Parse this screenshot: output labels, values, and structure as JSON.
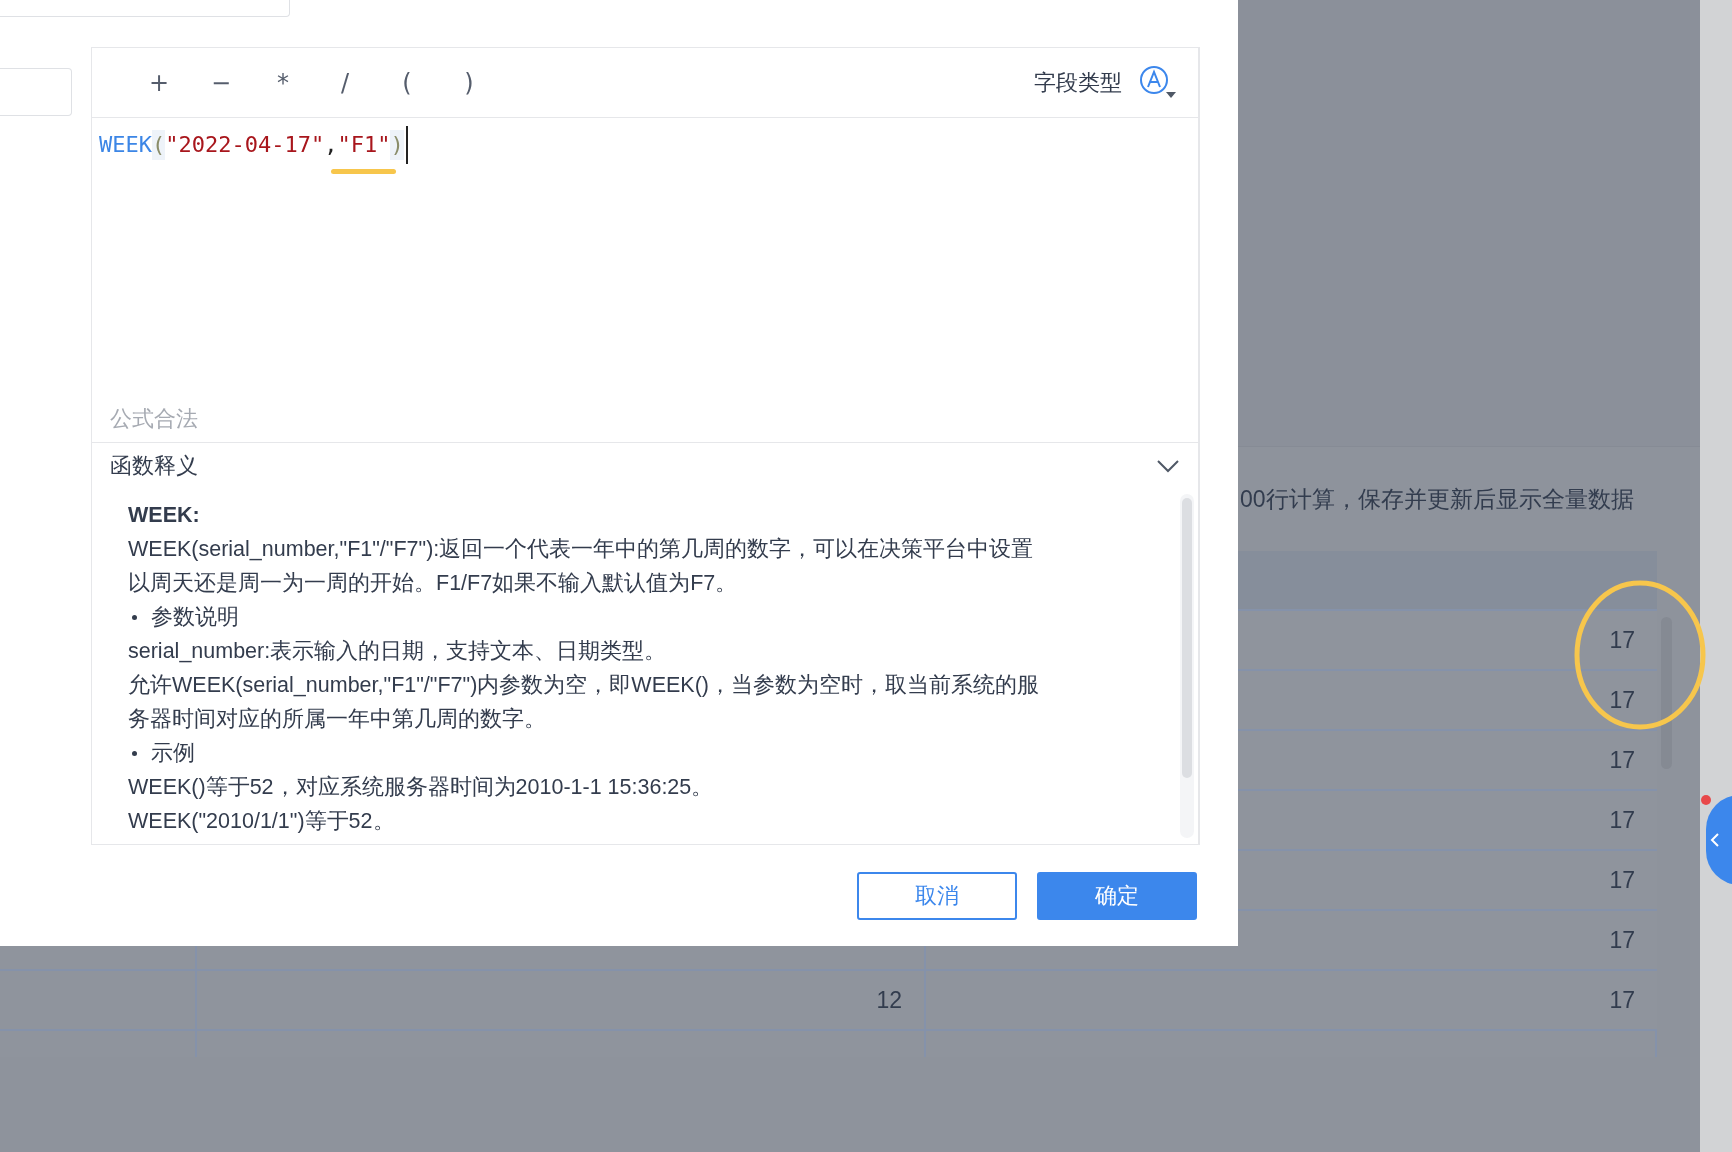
{
  "toolbar": {
    "operators": [
      "+",
      "−",
      "*",
      "/",
      "(",
      ")"
    ],
    "field_type_label": "字段类型"
  },
  "editor": {
    "tokens": [
      {
        "kind": "function",
        "text": "WEEK",
        "underlined": false
      },
      {
        "kind": "paren",
        "text": "(",
        "underlined": false
      },
      {
        "kind": "string",
        "text": "\"2022-04-17\"",
        "underlined": false
      },
      {
        "kind": "punct",
        "text": ",",
        "underlined": false
      },
      {
        "kind": "string",
        "text": "\"F1\"",
        "underlined": true
      },
      {
        "kind": "paren",
        "text": ")",
        "underlined": false
      }
    ],
    "status": "公式合法"
  },
  "help": {
    "title": "函数释义",
    "expanded": true,
    "heading": "WEEK:",
    "lines": [
      {
        "kind": "text",
        "text": "WEEK(serial_number,\"F1\"/\"F7\"):返回一个代表一年中的第几周的数字，可以在决策平台中设置"
      },
      {
        "kind": "text",
        "text": "以周天还是周一为一周的开始。F1/F7如果不输入默认值为F7。"
      },
      {
        "kind": "bullet",
        "text": "参数说明"
      },
      {
        "kind": "text",
        "text": "serial_number:表示输入的日期，支持文本、日期类型。"
      },
      {
        "kind": "text",
        "text": "允许WEEK(serial_number,\"F1\"/\"F7\")内参数为空，即WEEK()，当参数为空时，取当前系统的服"
      },
      {
        "kind": "text",
        "text": "务器时间对应的所属一年中第几周的数字。"
      },
      {
        "kind": "bullet",
        "text": "示例"
      },
      {
        "kind": "text",
        "text": "WEEK()等于52，对应系统服务器时间为2010-1-1 15:36:25。"
      },
      {
        "kind": "text",
        "text": "WEEK(\"2010/1/1\")等于52。"
      }
    ]
  },
  "buttons": [
    {
      "label": "取消",
      "kind": "secondary"
    },
    {
      "label": "确定",
      "kind": "primary"
    }
  ],
  "background": {
    "notice": "00行计算，保存并更新后显示全量数据",
    "rows": [
      {
        "column_3": "17"
      },
      {
        "column_3": "17"
      },
      {
        "column_3": "17"
      },
      {
        "column_3": "17"
      },
      {
        "column_3": "17"
      },
      {
        "column_3": "17"
      },
      {
        "column_2": "12",
        "column_3": "17"
      }
    ]
  }
}
